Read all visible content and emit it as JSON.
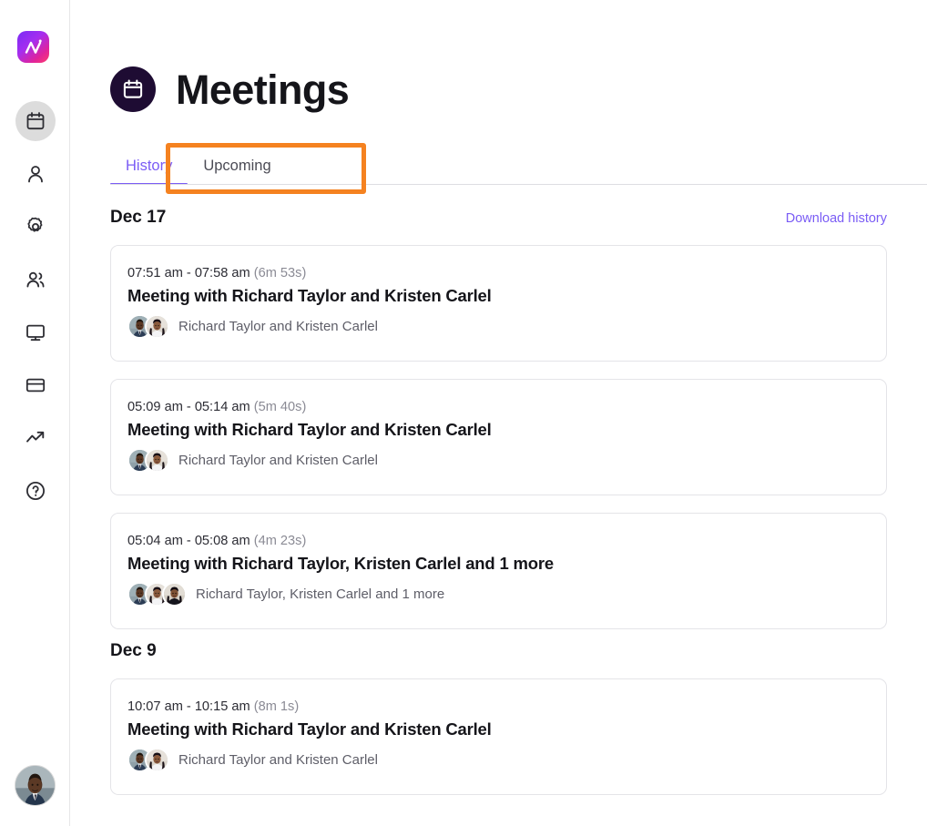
{
  "app": {
    "logo_name": "ai-logo",
    "brand_gradient_from": "#7a2bf5",
    "brand_gradient_to": "#ff3d6e"
  },
  "sidebar": {
    "items": [
      {
        "icon": "calendar-icon",
        "label": "Meetings",
        "active": true
      },
      {
        "icon": "person-icon",
        "label": "Contacts",
        "active": false
      },
      {
        "icon": "gear-icon",
        "label": "Settings",
        "active": false
      },
      {
        "icon": "people-icon",
        "label": "Team",
        "active": false
      },
      {
        "icon": "monitor-icon",
        "label": "Devices",
        "active": false
      },
      {
        "icon": "credit-card-icon",
        "label": "Billing",
        "active": false
      },
      {
        "icon": "trending-up-icon",
        "label": "Analytics",
        "active": false
      },
      {
        "icon": "help-circle-icon",
        "label": "Help",
        "active": false
      }
    ],
    "user_avatar_name": "user-avatar"
  },
  "header": {
    "icon": "calendar-icon",
    "icon_bg": "#1e0c33",
    "title": "Meetings"
  },
  "tabs": {
    "accent_color": "#7a5cf5",
    "items": [
      {
        "label": "History",
        "active": true
      },
      {
        "label": "Upcoming",
        "active": false
      }
    ],
    "highlight_color": "#f58220"
  },
  "groups": [
    {
      "date": "Dec 17",
      "download_label": "Download history",
      "meetings": [
        {
          "time": "07:51 am - 07:58 am",
          "duration": "(6m 53s)",
          "title": "Meeting with Richard Taylor and Kristen Carlel",
          "participants": "Richard Taylor and Kristen Carlel",
          "avatar_count": 2
        },
        {
          "time": "05:09 am - 05:14 am",
          "duration": "(5m 40s)",
          "title": "Meeting with Richard Taylor and Kristen Carlel",
          "participants": "Richard Taylor and Kristen Carlel",
          "avatar_count": 2
        },
        {
          "time": "05:04 am - 05:08 am",
          "duration": "(4m 23s)",
          "title": "Meeting with Richard Taylor, Kristen Carlel and 1 more",
          "participants": "Richard Taylor, Kristen Carlel and 1 more",
          "avatar_count": 3
        }
      ]
    },
    {
      "date": "Dec 9",
      "download_label": "",
      "meetings": [
        {
          "time": "10:07 am - 10:15 am",
          "duration": "(8m 1s)",
          "title": "Meeting with Richard Taylor and Kristen Carlel",
          "participants": "Richard Taylor and Kristen Carlel",
          "avatar_count": 2
        }
      ]
    }
  ]
}
